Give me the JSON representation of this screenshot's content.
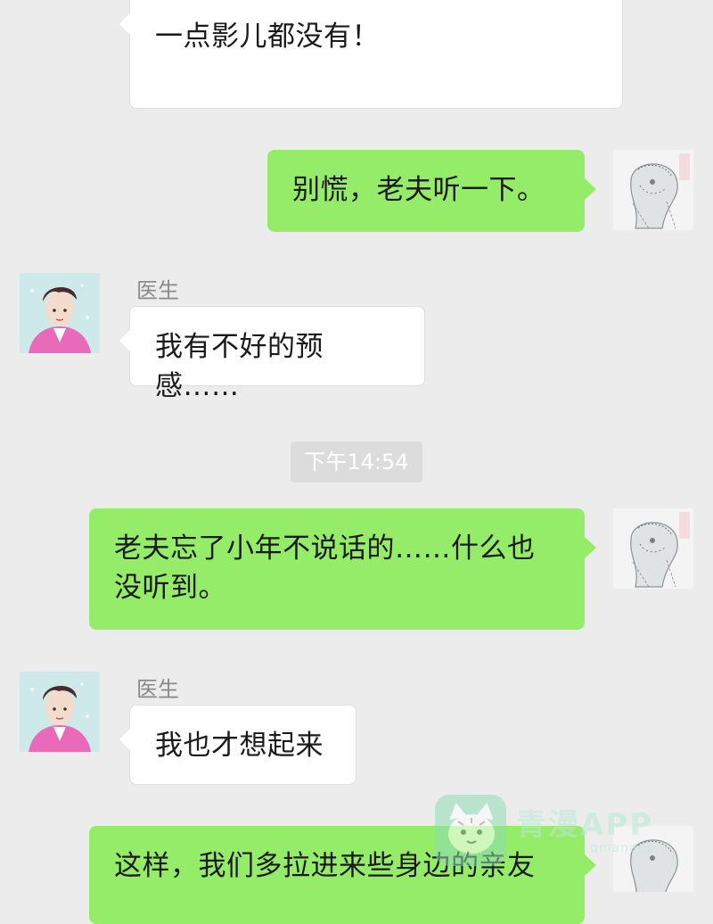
{
  "messages": [
    {
      "id": "m1",
      "direction": "in",
      "sender": "",
      "text": "一点影儿都没有！"
    },
    {
      "id": "m2",
      "direction": "out",
      "text": "别慌，老夫听一下。"
    },
    {
      "id": "m3",
      "direction": "in",
      "sender": "医生",
      "text": "我有不好的预感……"
    },
    {
      "id": "m4",
      "direction": "out",
      "text": "老夫忘了小年不说话的……什么也没听到。"
    },
    {
      "id": "m5",
      "direction": "in",
      "sender": "医生",
      "text": "我也才想起来"
    },
    {
      "id": "m6",
      "direction": "out",
      "text": "这样，我们多拉进来些身边的亲友"
    }
  ],
  "timestamp": "下午14:54",
  "watermark": {
    "logo_text": "青漫APP",
    "sub_text": "qmanapp"
  },
  "colors": {
    "background": "#ececec",
    "bubble_in": "#ffffff",
    "bubble_out": "#95ec69",
    "timestamp_chip": "#dcdcdc",
    "sender_name": "#8a8a8a"
  },
  "icons": {
    "doctor_avatar": "doctor-avatar",
    "self_avatar": "white-haired-avatar",
    "watermark_logo": "cat-logo-icon"
  }
}
